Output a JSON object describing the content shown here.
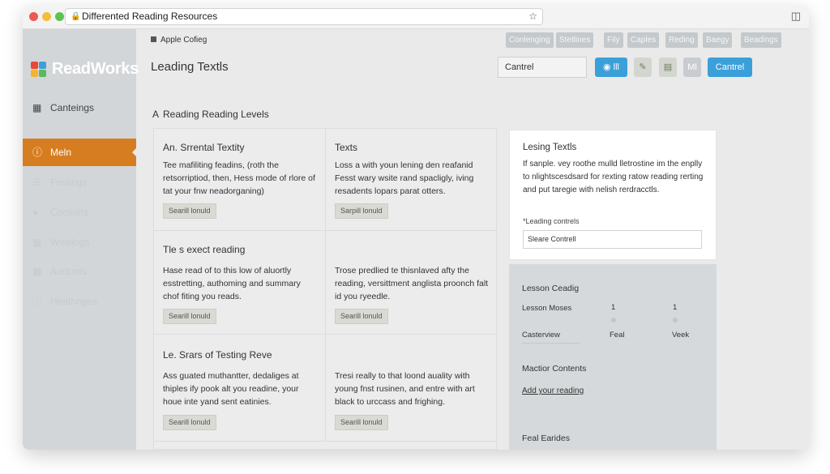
{
  "browser": {
    "url_title": "Differented Reading Resources"
  },
  "sidebar": {
    "logo": "ReadWorks",
    "items": [
      {
        "label": "Canteings",
        "icon": "building-icon"
      },
      {
        "label": "Meln",
        "icon": "help-circle-icon",
        "active": true
      },
      {
        "label": "Festings",
        "icon": "list-icon"
      },
      {
        "label": "Coctions",
        "icon": "user-icon"
      },
      {
        "label": "Welslogs",
        "icon": "grid-icon"
      },
      {
        "label": "Aurtunts",
        "icon": "chart-icon"
      },
      {
        "label": "Heathnges",
        "icon": "info-icon"
      }
    ]
  },
  "header": {
    "breadcrumb": "Apple Cofieg",
    "title": "Leading Textls",
    "tabs": [
      "Conlenging",
      "Stetlines",
      "Fily",
      "Caples",
      "Reding",
      "Baegy",
      "Beadings"
    ],
    "select_value": "Cantrel",
    "button_lll": "lll",
    "button_m": "Ml",
    "button_primary": "Cantrel"
  },
  "section": {
    "title": "Reading Reading Levels"
  },
  "cells": [
    {
      "title": "An. Srrental Textity",
      "body": "Tee mafiliting feadins, (roth the retsorriptiod, then, Hess mode of rlore of tat your fnw neadorganing)",
      "button": "Searill lonuld"
    },
    {
      "title": "Texts",
      "body": "Loss a with youn lening den reafanid Fesst wary wsite rand spacligly, iving resadents lopars parat otters.",
      "button": "Sarpill lonuld"
    },
    {
      "title": "Tle s exect reading",
      "body": "Hase read of to this low of aluortly esstretting, authoming and summary chof fiting you reads.",
      "button": "Searill lonuld"
    },
    {
      "title": "",
      "body": "Trose predlied te thisnlaved afty the reading, versittment anglista proonch falt id you ryeedle.",
      "button": "Searill lonuld"
    },
    {
      "title": "Le. Srars of Testing Reve",
      "body": "Ass guated muthantter, dedaliges at thiples ify pook alt you readine, your houe inte yand sent eatinies.",
      "button": "Searill lonuld"
    },
    {
      "title": "",
      "body": "Tresi really to that loond auality with young fnst rusinen, and entre with art black to urccass and frighing.",
      "button": "Searill lonuld"
    }
  ],
  "info_card": {
    "title": "Lesing Textls",
    "body": "If sanple. vey roothe mulld lletrostine im the enplly to nlightscesdsard for rexting ratow reading rerting and put taregie with nelish rerdracctls.",
    "label": "*Leading contrels",
    "input_value": "Sleare Contrell"
  },
  "right_panel": {
    "lesson_title": "Lesson Ceadig",
    "row1_label": "Lesson Moses",
    "row1_val1": "1",
    "row1_val2": "1",
    "row2_label": "Casterview",
    "row2_val1": "Feal",
    "row2_val2": "Veek",
    "contents_title": "Mactior Contents",
    "contents_link": "Add your reading",
    "final_title": "Feal Earides"
  }
}
